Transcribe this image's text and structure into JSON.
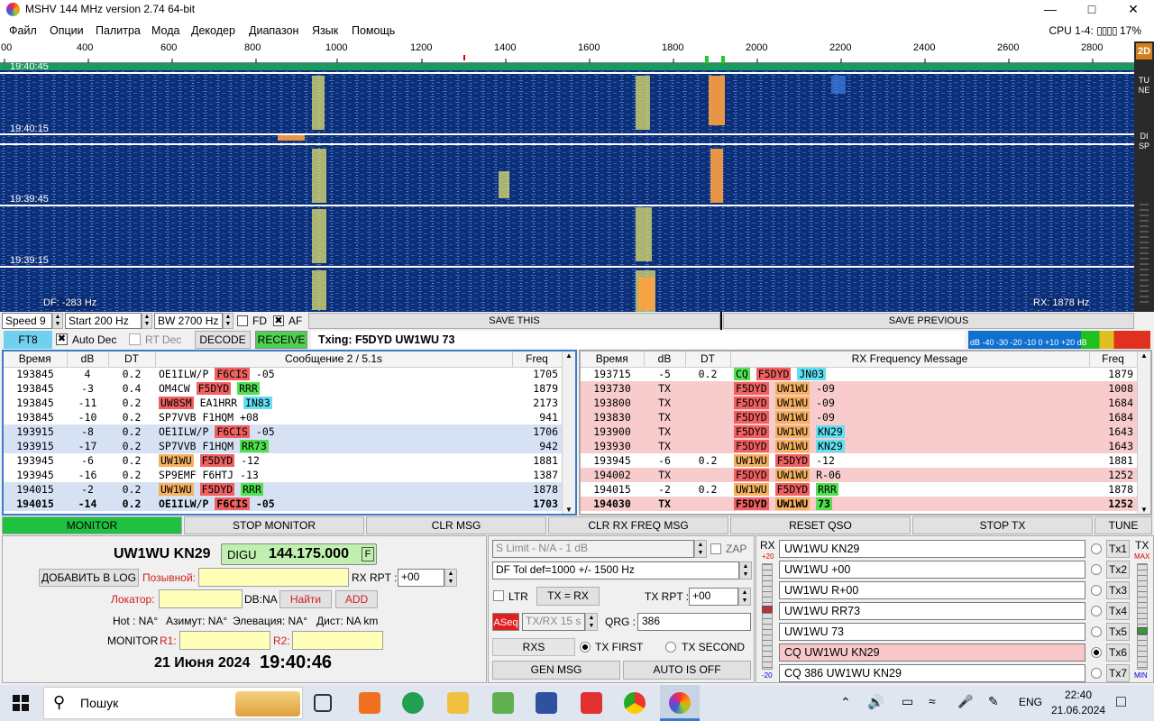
{
  "window": {
    "title": "MSHV 144 MHz version 2.74 64-bit",
    "cpu": "CPU 1-4:",
    "cpu_pct": "17%"
  },
  "menu": [
    "Файл",
    "Опции",
    "Палитра",
    "Мода",
    "Декодер",
    "Диапазон",
    "Язык",
    "Помощь"
  ],
  "scale_ticks": [
    "00",
    "400",
    "600",
    "800",
    "1000",
    "1200",
    "1400",
    "1600",
    "1800",
    "2000",
    "2200",
    "2400",
    "2600",
    "2800"
  ],
  "waterfall": {
    "times": [
      "19:40:45",
      "19:40:15",
      "19:39:45",
      "19:39:15"
    ],
    "df": "DF: -283 Hz",
    "rx": "RX: 1878 Hz"
  },
  "side_labels": {
    "mode2d": "2D",
    "tune": "TUNE",
    "disp": "DISP"
  },
  "ctl1": {
    "speed": "Speed 9",
    "start": "Start 200 Hz",
    "bw": "BW 2700 Hz",
    "fd": "FD",
    "af": "AF",
    "save_this": "SAVE THIS",
    "save_prev": "SAVE PREVIOUS"
  },
  "ctl2": {
    "mode": "FT8",
    "auto_dec": "Auto Dec",
    "rt_dec": "RT Dec",
    "decode": "DECODE",
    "receive": "RECEIVE",
    "txing": "Txing: F5DYD UW1WU 73",
    "meter": "dB -40 -30 -20 -10 0 +10 +20 dB"
  },
  "left_table": {
    "headers": [
      "Время",
      "dB",
      "DT",
      "Сообщение 2 / 5.1s",
      "Freq"
    ],
    "rows": [
      {
        "t": "193845",
        "db": "4",
        "dt": "0.2",
        "msg": [
          [
            "OE1ILW/P",
            ""
          ],
          [
            "F6CIS",
            "red"
          ],
          [
            "-05",
            ""
          ]
        ],
        "f": "1705",
        "sel": false
      },
      {
        "t": "193845",
        "db": "-3",
        "dt": "0.4",
        "msg": [
          [
            "OM4CW",
            ""
          ],
          [
            "F5DYD",
            "red"
          ],
          [
            "RRR",
            "grn"
          ]
        ],
        "f": "1879",
        "sel": false
      },
      {
        "t": "193845",
        "db": "-11",
        "dt": "0.2",
        "msg": [
          [
            "UW8SM",
            "red"
          ],
          [
            "EA1HRR",
            ""
          ],
          [
            "IN83",
            "cyn"
          ]
        ],
        "f": "2173",
        "sel": false
      },
      {
        "t": "193845",
        "db": "-10",
        "dt": "0.2",
        "msg": [
          [
            "SP7VVB",
            ""
          ],
          [
            "F1HQM",
            ""
          ],
          [
            "+08",
            ""
          ]
        ],
        "f": "941",
        "sel": false
      },
      {
        "t": "193915",
        "db": "-8",
        "dt": "0.2",
        "msg": [
          [
            "OE1ILW/P",
            ""
          ],
          [
            "F6CIS",
            "red"
          ],
          [
            "-05",
            ""
          ]
        ],
        "f": "1706",
        "sel": true
      },
      {
        "t": "193915",
        "db": "-17",
        "dt": "0.2",
        "msg": [
          [
            "SP7VVB",
            ""
          ],
          [
            "F1HQM",
            ""
          ],
          [
            "RR73",
            "grn"
          ]
        ],
        "f": "942",
        "sel": true
      },
      {
        "t": "193945",
        "db": "-6",
        "dt": "0.2",
        "msg": [
          [
            "UW1WU",
            "org"
          ],
          [
            "F5DYD",
            "red"
          ],
          [
            "-12",
            ""
          ]
        ],
        "f": "1881",
        "sel": false
      },
      {
        "t": "193945",
        "db": "-16",
        "dt": "0.2",
        "msg": [
          [
            "SP9EMF",
            ""
          ],
          [
            "F6HTJ",
            ""
          ],
          [
            "-13",
            ""
          ]
        ],
        "f": "1387",
        "sel": false
      },
      {
        "t": "194015",
        "db": "-2",
        "dt": "0.2",
        "msg": [
          [
            "UW1WU",
            "org"
          ],
          [
            "F5DYD",
            "red"
          ],
          [
            "RRR",
            "grn"
          ]
        ],
        "f": "1878",
        "sel": true
      },
      {
        "t": "194015",
        "db": "-14",
        "dt": "0.2",
        "msg": [
          [
            "OE1ILW/P",
            ""
          ],
          [
            "F6CIS",
            "red"
          ],
          [
            "-05",
            ""
          ]
        ],
        "f": "1703",
        "sel": true,
        "bold": true
      }
    ]
  },
  "right_table": {
    "headers": [
      "Время",
      "dB",
      "DT",
      "RX Frequency Message",
      "Freq"
    ],
    "rows": [
      {
        "t": "193715",
        "db": "-5",
        "dt": "0.2",
        "msg": [
          [
            "CQ",
            "grn"
          ],
          [
            "F5DYD",
            "red"
          ],
          [
            "JN03",
            "cyn"
          ]
        ],
        "f": "1879",
        "tx": false
      },
      {
        "t": "193730",
        "db": "TX",
        "dt": "",
        "msg": [
          [
            "F5DYD",
            "red"
          ],
          [
            "UW1WU",
            "org"
          ],
          [
            "-09",
            ""
          ]
        ],
        "f": "1008",
        "tx": true
      },
      {
        "t": "193800",
        "db": "TX",
        "dt": "",
        "msg": [
          [
            "F5DYD",
            "red"
          ],
          [
            "UW1WU",
            "org"
          ],
          [
            "-09",
            ""
          ]
        ],
        "f": "1684",
        "tx": true
      },
      {
        "t": "193830",
        "db": "TX",
        "dt": "",
        "msg": [
          [
            "F5DYD",
            "red"
          ],
          [
            "UW1WU",
            "org"
          ],
          [
            "-09",
            ""
          ]
        ],
        "f": "1684",
        "tx": true
      },
      {
        "t": "193900",
        "db": "TX",
        "dt": "",
        "msg": [
          [
            "F5DYD",
            "red"
          ],
          [
            "UW1WU",
            "org"
          ],
          [
            "KN29",
            "cyn"
          ]
        ],
        "f": "1643",
        "tx": true
      },
      {
        "t": "193930",
        "db": "TX",
        "dt": "",
        "msg": [
          [
            "F5DYD",
            "red"
          ],
          [
            "UW1WU",
            "org"
          ],
          [
            "KN29",
            "cyn"
          ]
        ],
        "f": "1643",
        "tx": true
      },
      {
        "t": "193945",
        "db": "-6",
        "dt": "0.2",
        "msg": [
          [
            "UW1WU",
            "org"
          ],
          [
            "F5DYD",
            "red"
          ],
          [
            "-12",
            ""
          ]
        ],
        "f": "1881",
        "tx": false
      },
      {
        "t": "194002",
        "db": "TX",
        "dt": "",
        "msg": [
          [
            "F5DYD",
            "red"
          ],
          [
            "UW1WU",
            "org"
          ],
          [
            "R-06",
            ""
          ]
        ],
        "f": "1252",
        "tx": true
      },
      {
        "t": "194015",
        "db": "-2",
        "dt": "0.2",
        "msg": [
          [
            "UW1WU",
            "org"
          ],
          [
            "F5DYD",
            "red"
          ],
          [
            "RRR",
            "grn"
          ]
        ],
        "f": "1878",
        "tx": false
      },
      {
        "t": "194030",
        "db": "TX",
        "dt": "",
        "msg": [
          [
            "F5DYD",
            "red"
          ],
          [
            "UW1WU",
            "org"
          ],
          [
            "73",
            "grn"
          ]
        ],
        "f": "1252",
        "tx": true,
        "bold": true
      }
    ]
  },
  "buttons": [
    "MONITOR",
    "STOP MONITOR",
    "CLR MSG",
    "CLR RX FREQ MSG",
    "RESET QSO",
    "STOP TX",
    "TUNE"
  ],
  "left": {
    "call": "UW1WU KN29",
    "digu": "DIGU",
    "freq": "144.175.000",
    "f": "F",
    "add_log": "ДОБАВИТЬ В LOG",
    "callsign_lbl": "Позывной:",
    "rx_rpt_lbl": "RX RPT :",
    "rx_rpt": "+00",
    "locator_lbl": "Локатор:",
    "db_na": "DB:NA",
    "find": "Найти",
    "add": "ADD",
    "hot": "Hot : NA°",
    "azim": "Азимут: NA°",
    "elev": "Элевация: NA°",
    "dist": "Дист: NA km",
    "monitor": "MONITOR",
    "r1": "R1:",
    "r2": "R2:",
    "date": "21 Июня 2024",
    "time": "19:40:46"
  },
  "mid": {
    "slimit": "S Limit - N/A - 1  dB",
    "zap": "ZAP",
    "dftol": "DF Tol def=1000 +/-  1500  Hz",
    "ltr": "LTR",
    "txrx": "TX = RX",
    "txrpt_lbl": "TX RPT :",
    "txrpt": "+00",
    "aseq": "ASeq",
    "txrx15": "TX/RX 15  s",
    "qrg_lbl": "QRG :",
    "qrg": "386",
    "rxs": "RXS",
    "tx_first": "TX FIRST",
    "tx_second": "TX SECOND",
    "gen_msg": "GEN MSG",
    "auto": "AUTO IS OFF"
  },
  "right": {
    "rx": "RX",
    "rx_top": "+20",
    "rx_bot": "-20",
    "tx": "TX",
    "tx_max": "MAX",
    "tx_min": "MIN",
    "msgs": [
      {
        "text": "UW1WU KN29",
        "btn": "Tx1"
      },
      {
        "text": "UW1WU +00",
        "btn": "Tx2"
      },
      {
        "text": "UW1WU R+00",
        "btn": "Tx3"
      },
      {
        "text": "UW1WU RR73",
        "btn": "Tx4"
      },
      {
        "text": "UW1WU 73",
        "btn": "Tx5"
      },
      {
        "text": "CQ UW1WU KN29",
        "btn": "Tx6"
      },
      {
        "text": "CQ 386 UW1WU KN29",
        "btn": "Tx7"
      }
    ]
  },
  "taskbar": {
    "search": "Пошук",
    "lang": "ENG",
    "time": "22:40",
    "date": "21.06.2024"
  }
}
